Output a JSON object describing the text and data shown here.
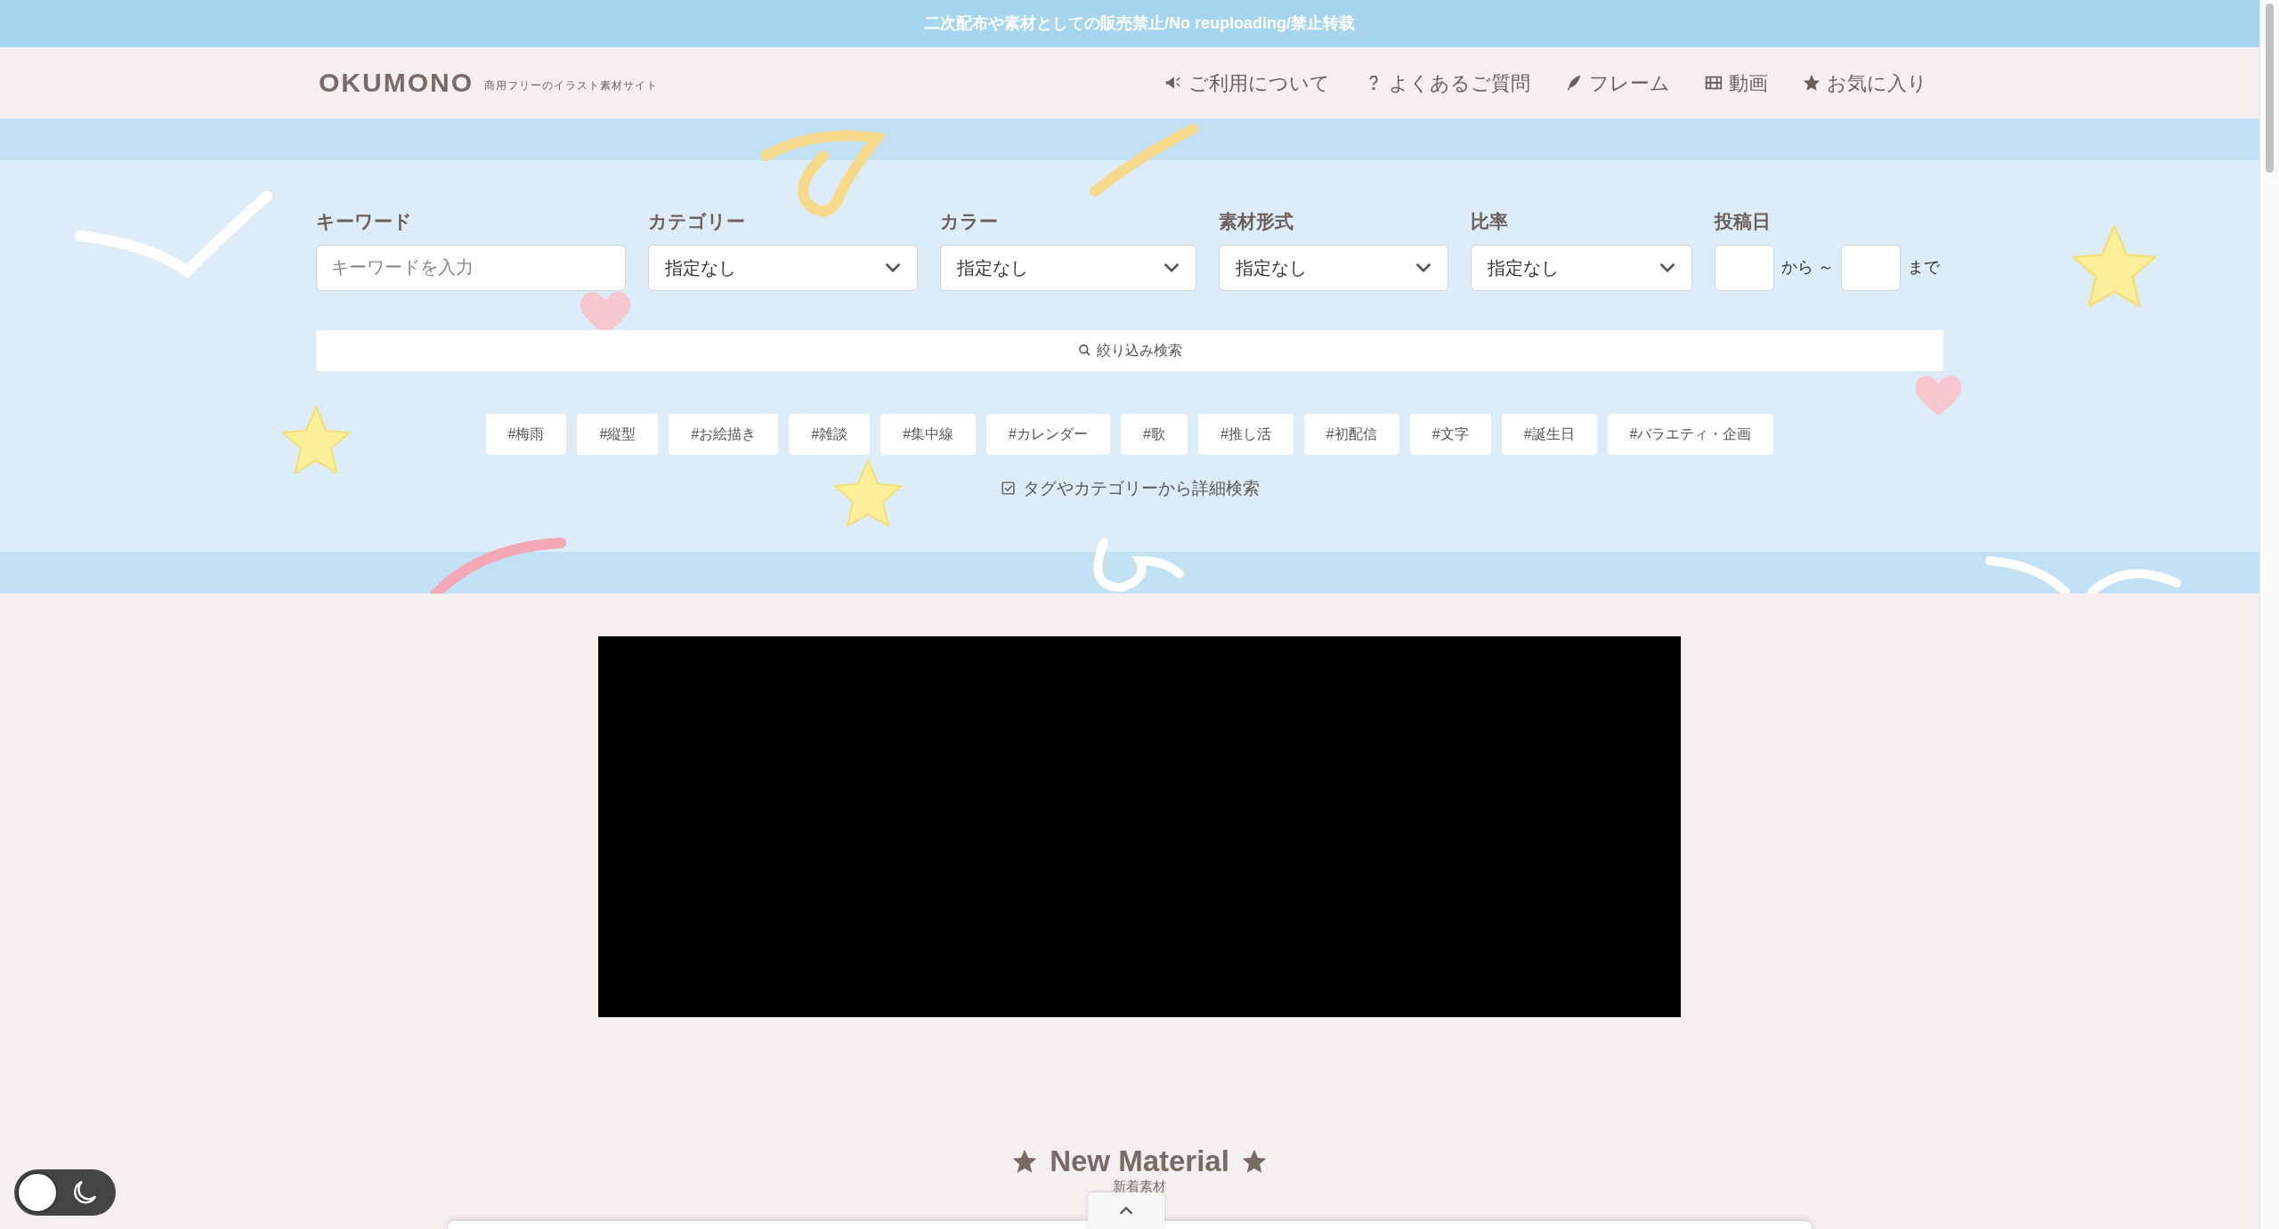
{
  "banner": {
    "text": "二次配布や素材としての販売禁止/No reuploading/禁止转载"
  },
  "header": {
    "logo": "OKUMONO",
    "tagline": "商用フリーのイラスト素材サイト",
    "nav": [
      {
        "kind": "megaphone",
        "label": "ご利用について"
      },
      {
        "kind": "question",
        "label": "よくあるご質問"
      },
      {
        "kind": "feather",
        "label": "フレーム"
      },
      {
        "kind": "film",
        "label": "動画"
      },
      {
        "kind": "star",
        "label": "お気に入り"
      }
    ]
  },
  "search": {
    "keyword": {
      "label": "キーワード",
      "placeholder": "キーワードを入力"
    },
    "selects": [
      {
        "label": "カテゴリー",
        "value": "指定なし"
      },
      {
        "label": "カラー",
        "value": "指定なし"
      },
      {
        "label": "素材形式",
        "value": "指定なし"
      },
      {
        "label": "比率",
        "value": "指定なし"
      }
    ],
    "date": {
      "label": "投稿日",
      "from": "から ～",
      "to": "まで"
    },
    "button": "絞り込み検索",
    "tags": [
      "#梅雨",
      "#縦型",
      "#お絵描き",
      "#雑談",
      "#集中線",
      "#カレンダー",
      "#歌",
      "#推し活",
      "#初配信",
      "#文字",
      "#誕生日",
      "#バラエティ・企画"
    ],
    "detail_link": "タグやカテゴリーから詳細検索"
  },
  "section": {
    "title": "New Material",
    "subtitle": "新着素材"
  },
  "dark_mode": {
    "on": false
  }
}
